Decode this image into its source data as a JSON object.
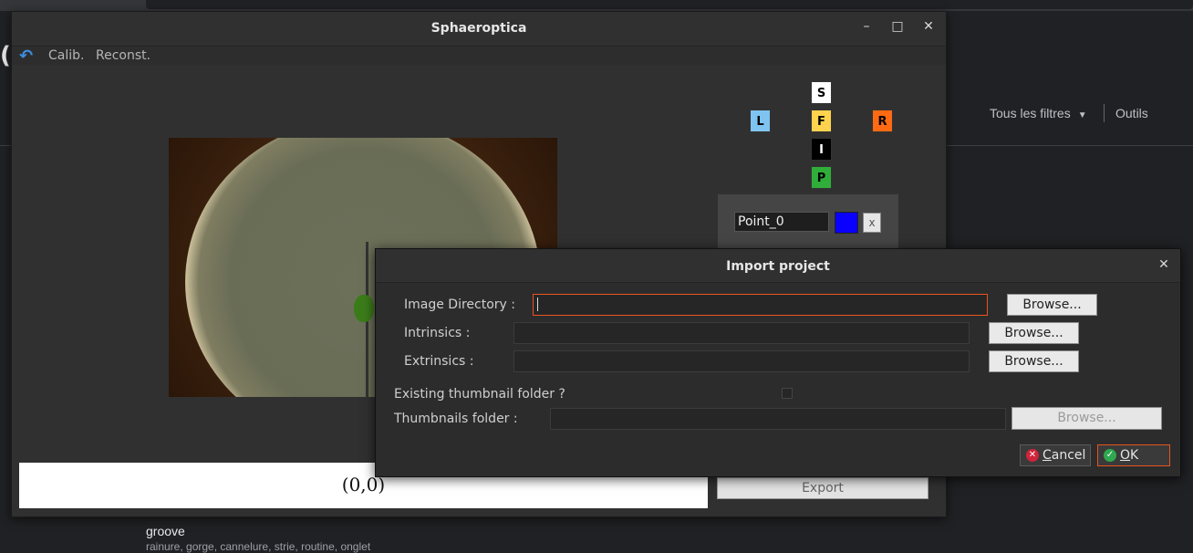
{
  "background": {
    "left_char": "(",
    "filters_label": "Tous les filtres",
    "tools_label": "Outils",
    "groove_title": "groove",
    "groove_synonyms": "rainure, gorge, cannelure, strie, routine, onglet"
  },
  "app": {
    "title": "Sphaeroptica",
    "menu": [
      "Calib.",
      "Reconst."
    ],
    "coordinates": "(0,0)",
    "direction_buttons": {
      "S": "S",
      "L": "L",
      "F": "F",
      "R": "R",
      "I": "I",
      "P": "P"
    },
    "colors": {
      "S": "#ffffff",
      "L": "#7fc3f0",
      "F": "#ffd34d",
      "R": "#ff6a13",
      "I": "#000000",
      "P": "#2fae3a"
    },
    "point": {
      "name": "Point_0",
      "color": "#0a00ff",
      "delete_label": "x"
    },
    "export_label": "Export"
  },
  "dialog": {
    "title": "Import project",
    "image_directory_label": "Image Directory :",
    "image_directory_value": "",
    "intrinsics_label": "Intrinsics :",
    "intrinsics_value": "",
    "extrinsics_label": "Extrinsics :",
    "extrinsics_value": "",
    "existing_thumbnail_label": "Existing thumbnail folder ?",
    "existing_thumbnail_checked": false,
    "thumbnails_folder_label": "Thumbnails folder :",
    "thumbnails_folder_value": "",
    "browse_label": "Browse...",
    "cancel_label_first": "C",
    "cancel_label_rest": "ancel",
    "ok_label_first": "O",
    "ok_label_rest": "K",
    "accent_color": "#e95420"
  }
}
